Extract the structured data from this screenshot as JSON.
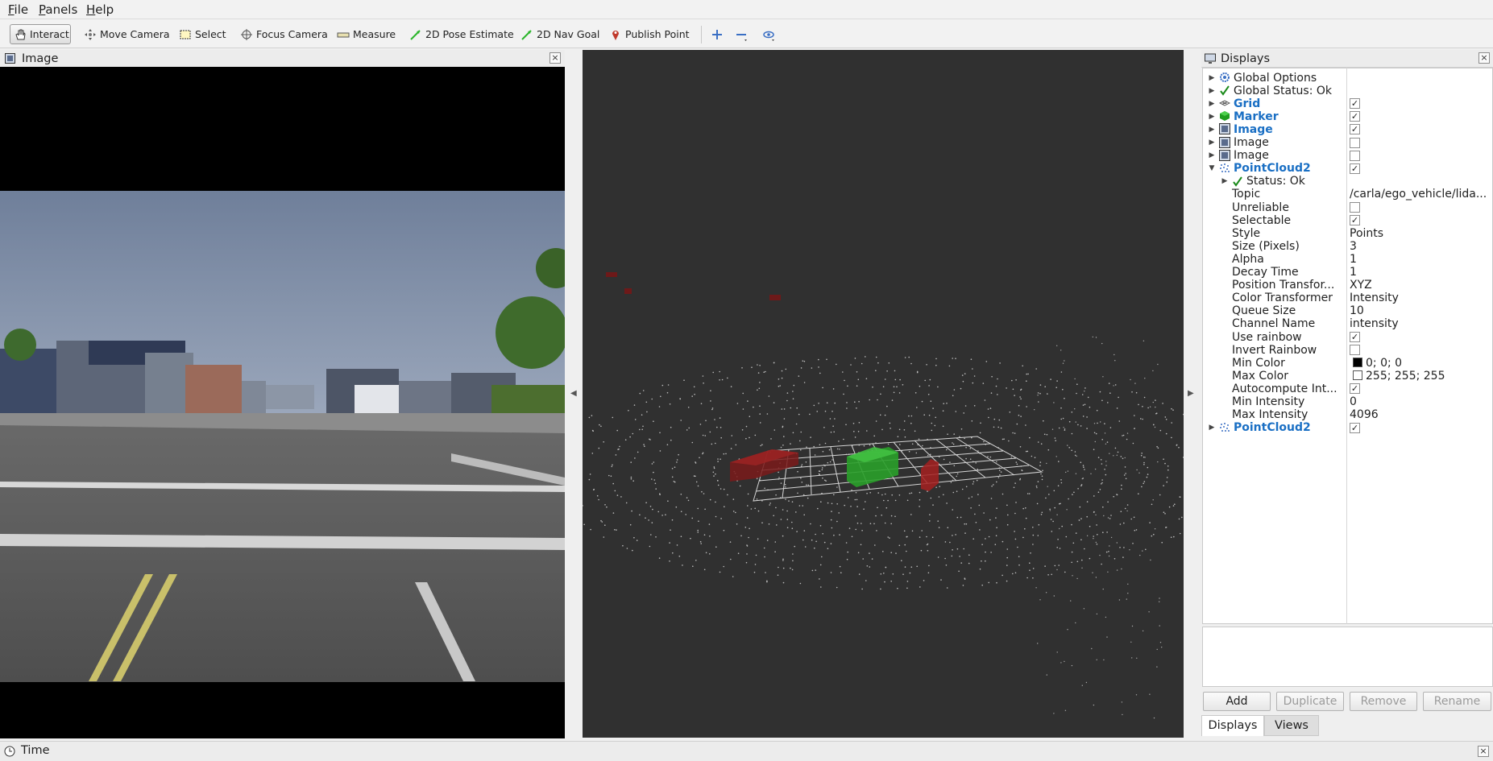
{
  "menubar": {
    "items": [
      "File",
      "Panels",
      "Help"
    ]
  },
  "toolbar": {
    "tools": [
      {
        "label": "Interact",
        "icon": "hand-icon"
      },
      {
        "label": "Move Camera",
        "icon": "move-camera-icon"
      },
      {
        "label": "Select",
        "icon": "select-icon"
      },
      {
        "label": "Focus Camera",
        "icon": "focus-camera-icon"
      },
      {
        "label": "Measure",
        "icon": "ruler-icon"
      },
      {
        "label": "2D Pose Estimate",
        "icon": "pose-arrow-icon"
      },
      {
        "label": "2D Nav Goal",
        "icon": "nav-arrow-icon"
      },
      {
        "label": "Publish Point",
        "icon": "map-pin-icon"
      }
    ]
  },
  "image_panel": {
    "title": "Image"
  },
  "displays_panel": {
    "title": "Displays",
    "rows": [
      {
        "label": "Global Options",
        "icon": "gear-icon"
      },
      {
        "label": "Global Status: Ok",
        "icon": "check-icon"
      },
      {
        "label": "Grid",
        "icon": "grid-icon",
        "checked": true
      },
      {
        "label": "Marker",
        "icon": "cube-icon",
        "checked": true
      },
      {
        "label": "Image",
        "icon": "image-icon",
        "checked": true
      },
      {
        "label": "Image",
        "icon": "image-icon",
        "checked": false
      },
      {
        "label": "Image",
        "icon": "image-icon",
        "checked": false
      },
      {
        "label": "PointCloud2",
        "icon": "pointcloud-icon",
        "checked": true
      },
      {
        "label": "Status: Ok",
        "icon": "check-icon"
      },
      {
        "label": "Topic",
        "value": "/carla/ego_vehicle/lida..."
      },
      {
        "label": "Unreliable",
        "checked": false
      },
      {
        "label": "Selectable",
        "checked": true
      },
      {
        "label": "Style",
        "value": "Points"
      },
      {
        "label": "Size (Pixels)",
        "value": "3"
      },
      {
        "label": "Alpha",
        "value": "1"
      },
      {
        "label": "Decay Time",
        "value": "1"
      },
      {
        "label": "Position Transfor...",
        "value": "XYZ"
      },
      {
        "label": "Color Transformer",
        "value": "Intensity"
      },
      {
        "label": "Queue Size",
        "value": "10"
      },
      {
        "label": "Channel Name",
        "value": "intensity"
      },
      {
        "label": "Use rainbow",
        "checked": true
      },
      {
        "label": "Invert Rainbow",
        "checked": false
      },
      {
        "label": "Min Color",
        "value": "0; 0; 0",
        "swatch": "#000000"
      },
      {
        "label": "Max Color",
        "value": "255; 255; 255",
        "swatch": "#ffffff"
      },
      {
        "label": "Autocompute Int...",
        "checked": true
      },
      {
        "label": "Min Intensity",
        "value": "0"
      },
      {
        "label": "Max Intensity",
        "value": "4096"
      },
      {
        "label": "PointCloud2",
        "icon": "pointcloud-icon",
        "checked": true
      }
    ],
    "buttons": [
      "Add",
      "Duplicate",
      "Remove",
      "Rename"
    ],
    "tabs": [
      "Displays",
      "Views"
    ]
  },
  "time_panel": {
    "title": "Time"
  },
  "colors": {
    "accent_blue": "#1a6fc4",
    "marker_red": "#8b1c1c",
    "marker_green": "#2fa12f",
    "background_3d": "#303030"
  }
}
